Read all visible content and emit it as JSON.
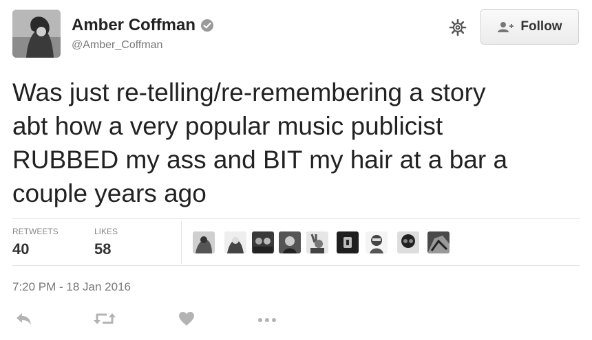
{
  "author": {
    "name": "Amber Coffman",
    "handle": "@Amber_Coffman",
    "verified_icon": "verified-badge-icon",
    "avatar_icon": "avatar-photo"
  },
  "header": {
    "settings_icon": "gear-icon",
    "follow_label": "Follow",
    "follow_icon": "add-user-icon"
  },
  "tweet": {
    "lines": [
      "Was just re-telling/re-remembering a story",
      "abt how a very popular music publicist",
      "RUBBED my ass and BIT my hair at a bar a",
      "couple years ago"
    ]
  },
  "stats": {
    "retweets_label": "RETWEETS",
    "retweets_count": "40",
    "likes_label": "LIKES",
    "likes_count": "58",
    "likers_count_shown": 9
  },
  "meta": {
    "timestamp": "7:20 PM - 18 Jan 2016"
  },
  "actions": [
    "reply-icon",
    "retweet-icon",
    "heart-icon",
    "more-icon"
  ],
  "colors": {
    "text": "#222222",
    "muted": "#777777",
    "divider": "#e3e3e3",
    "icon": "#b3b3b3"
  }
}
